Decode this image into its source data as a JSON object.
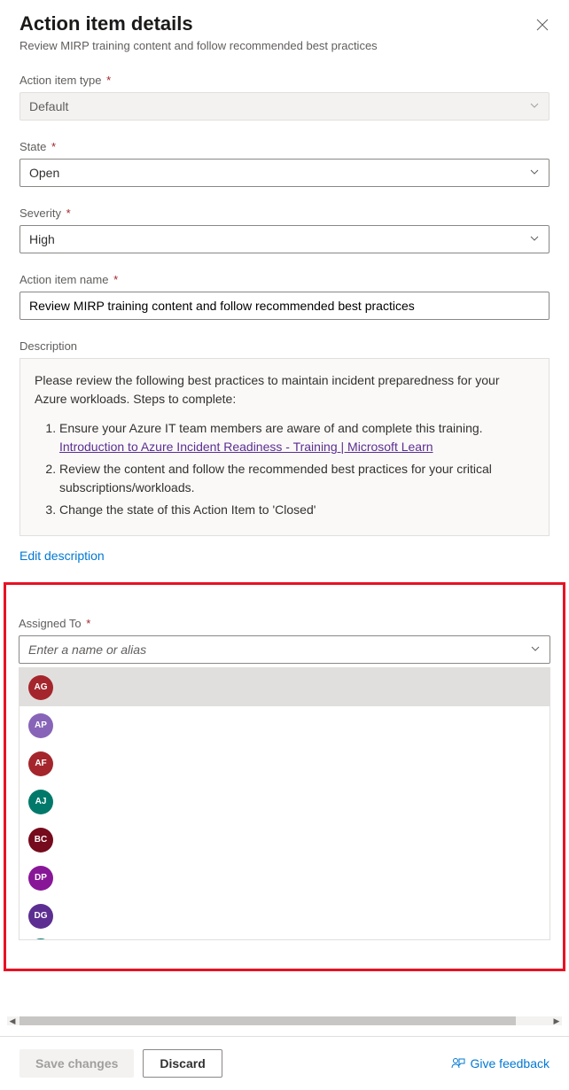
{
  "header": {
    "title": "Action item details",
    "subtitle": "Review MIRP training content and follow recommended best practices"
  },
  "fields": {
    "actionItemType": {
      "label": "Action item type",
      "value": "Default"
    },
    "state": {
      "label": "State",
      "value": "Open"
    },
    "severity": {
      "label": "Severity",
      "value": "High"
    },
    "actionItemName": {
      "label": "Action item name",
      "value": "Review MIRP training content and follow recommended best practices"
    },
    "description": {
      "label": "Description",
      "intro": "Please review the following best practices to maintain incident preparedness for your Azure workloads. Steps to complete:",
      "step1": "Ensure your Azure IT team members are aware of and complete this training.",
      "step1link": "Introduction to Azure Incident Readiness - Training | Microsoft Learn",
      "step2": "Review the content and follow the recommended best practices for your critical subscriptions/workloads.",
      "step3": "Change the state of this Action Item to 'Closed'",
      "editLink": "Edit description"
    },
    "assignedTo": {
      "label": "Assigned To",
      "placeholder": "Enter a name or alias"
    }
  },
  "assigneeOptions": [
    {
      "initials": "AG",
      "color": "#a4262c"
    },
    {
      "initials": "AP",
      "color": "#8764b8"
    },
    {
      "initials": "AF",
      "color": "#a4262c"
    },
    {
      "initials": "AJ",
      "color": "#00796b"
    },
    {
      "initials": "BC",
      "color": "#750b1c"
    },
    {
      "initials": "DP",
      "color": "#881798"
    },
    {
      "initials": "DG",
      "color": "#5c2e91"
    }
  ],
  "assigneePartial": {
    "color": "#00796b"
  },
  "footer": {
    "save": "Save changes",
    "discard": "Discard",
    "feedback": "Give feedback"
  }
}
